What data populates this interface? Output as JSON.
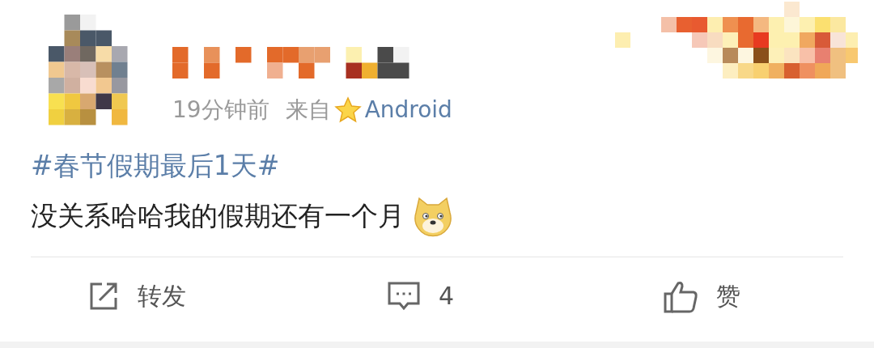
{
  "post": {
    "meta": {
      "time": "19分钟前",
      "source_prefix": "来自",
      "source": "Android"
    },
    "topic": "#春节假期最后1天#",
    "text": "没关系哈哈我的假期还有一个月"
  },
  "actions": [
    {
      "kind": "repost",
      "label": "转发"
    },
    {
      "kind": "comment",
      "label": "4"
    },
    {
      "kind": "like",
      "label": "赞"
    }
  ]
}
